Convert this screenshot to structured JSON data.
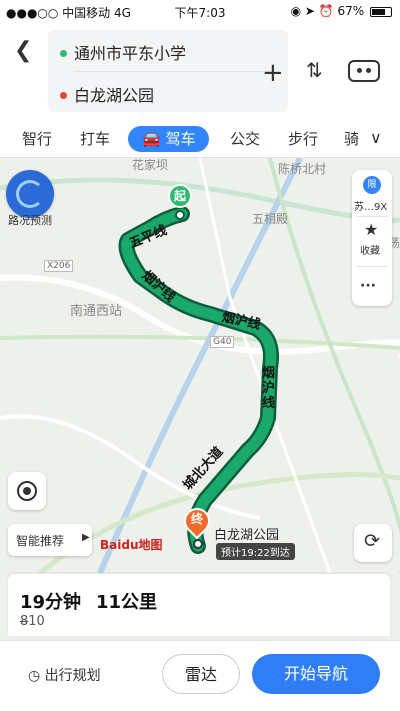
{
  "status_bar": {
    "carrier": "●●●○○ 中国移动  4G",
    "time": "下午7:03",
    "battery": "67%"
  },
  "header": {
    "back_icon": "chevron-left",
    "origin": "通州市平东小学",
    "destination": "白龙湖公园",
    "origin_color": "#2ebc6f",
    "destination_color": "#e5462f"
  },
  "tabs": [
    {
      "label": "智行",
      "active": false
    },
    {
      "label": "打车",
      "active": false
    },
    {
      "label": "驾车",
      "active": true
    },
    {
      "label": "公交",
      "active": false
    },
    {
      "label": "步行",
      "active": false
    },
    {
      "label": "骑",
      "active": false
    }
  ],
  "map": {
    "traffic_label": "路况预测",
    "labels": {
      "a": "花家坝",
      "b": "陈桥北村",
      "c": "五相殿",
      "d": "南通西站",
      "e": "X206",
      "f": "G40",
      "g": "荡"
    },
    "road_labels": [
      "五平线",
      "烟沪线",
      "烟沪线",
      "烟沪线",
      "城北大道"
    ],
    "start_marker": "起",
    "end_marker": "终",
    "dest_name": "白龙湖公园",
    "eta_badge": "预计19:22到达",
    "side_panel": {
      "plate_badge": "限",
      "plate": "苏…9X",
      "favorite": "收藏",
      "more": "···"
    },
    "smart_recommend": "智能推荐",
    "logo": "Baidu地图",
    "route_color": "#1aa86b"
  },
  "summary": {
    "duration": "19分钟",
    "distance": "11公里",
    "toll": "8",
    "lights": "10"
  },
  "footer": {
    "plan": "出行规划",
    "radar": "雷达",
    "navigate": "开始导航",
    "accent": "#2f7ef5"
  }
}
